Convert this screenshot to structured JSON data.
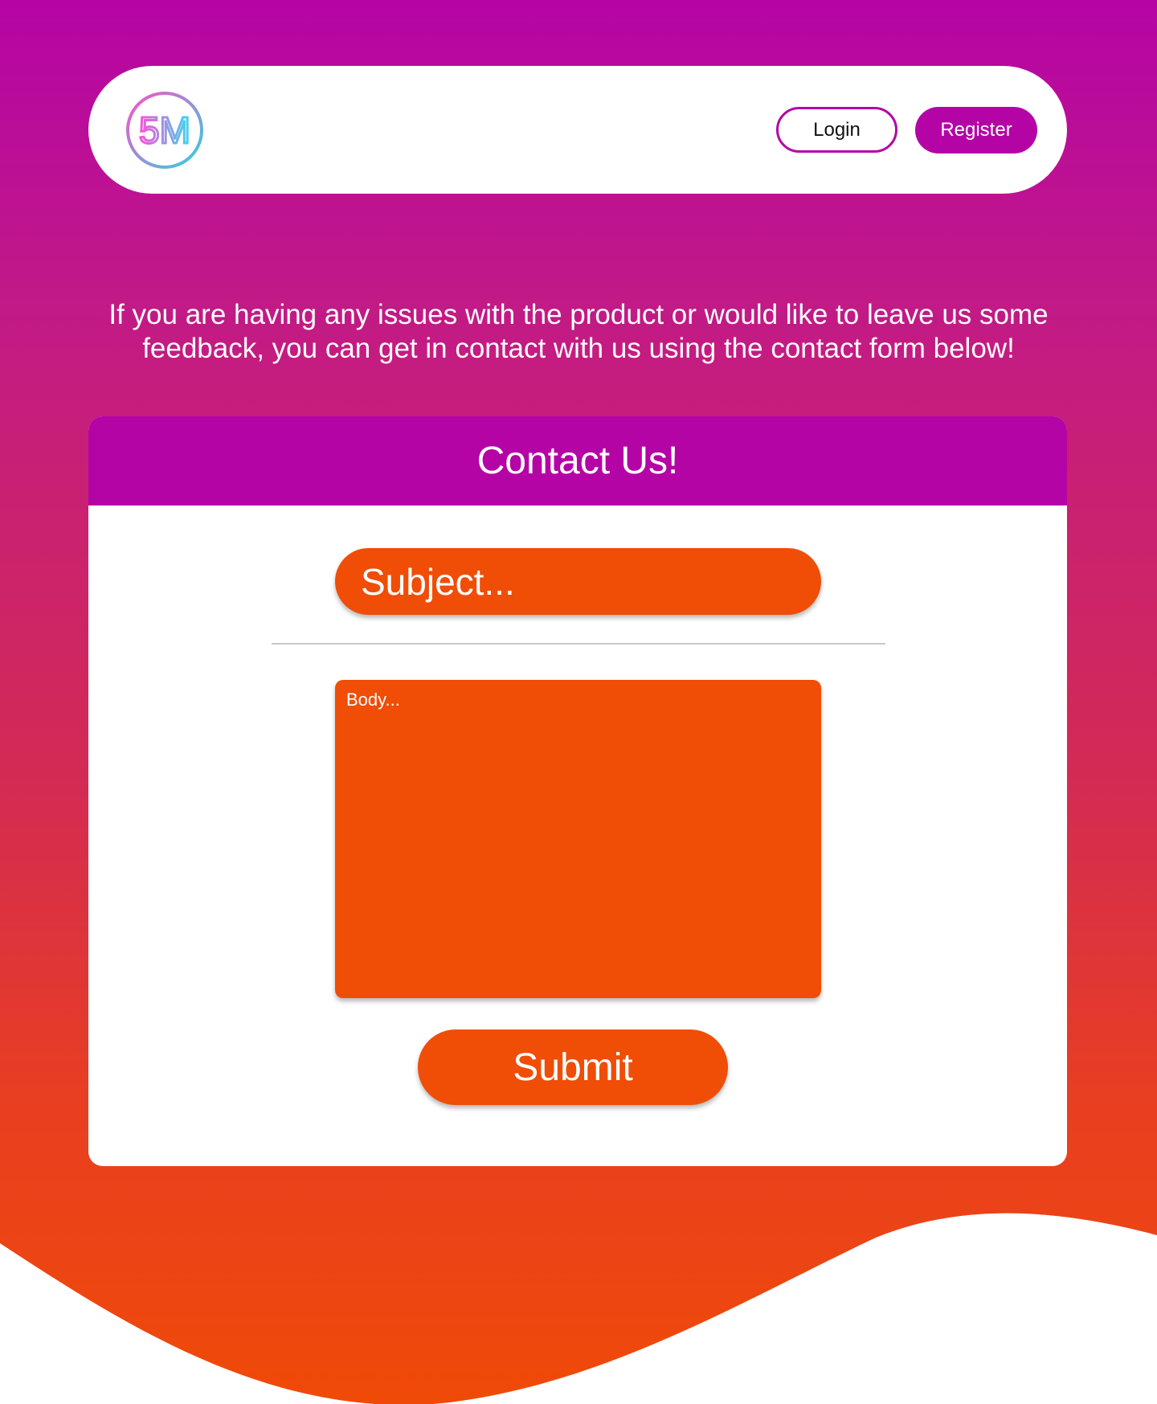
{
  "colors": {
    "brand_purple": "#b504a5",
    "accent_orange": "#f04d06",
    "white": "#ffffff"
  },
  "header": {
    "logo_text": "5M",
    "login_label": "Login",
    "register_label": "Register"
  },
  "intro": {
    "text": "If you are having any issues with the product or would like to leave us some feedback, you can get in contact with us using the contact form below!"
  },
  "contact_form": {
    "title": "Contact Us!",
    "subject_placeholder": "Subject...",
    "body_placeholder": "Body...",
    "submit_label": "Submit"
  }
}
